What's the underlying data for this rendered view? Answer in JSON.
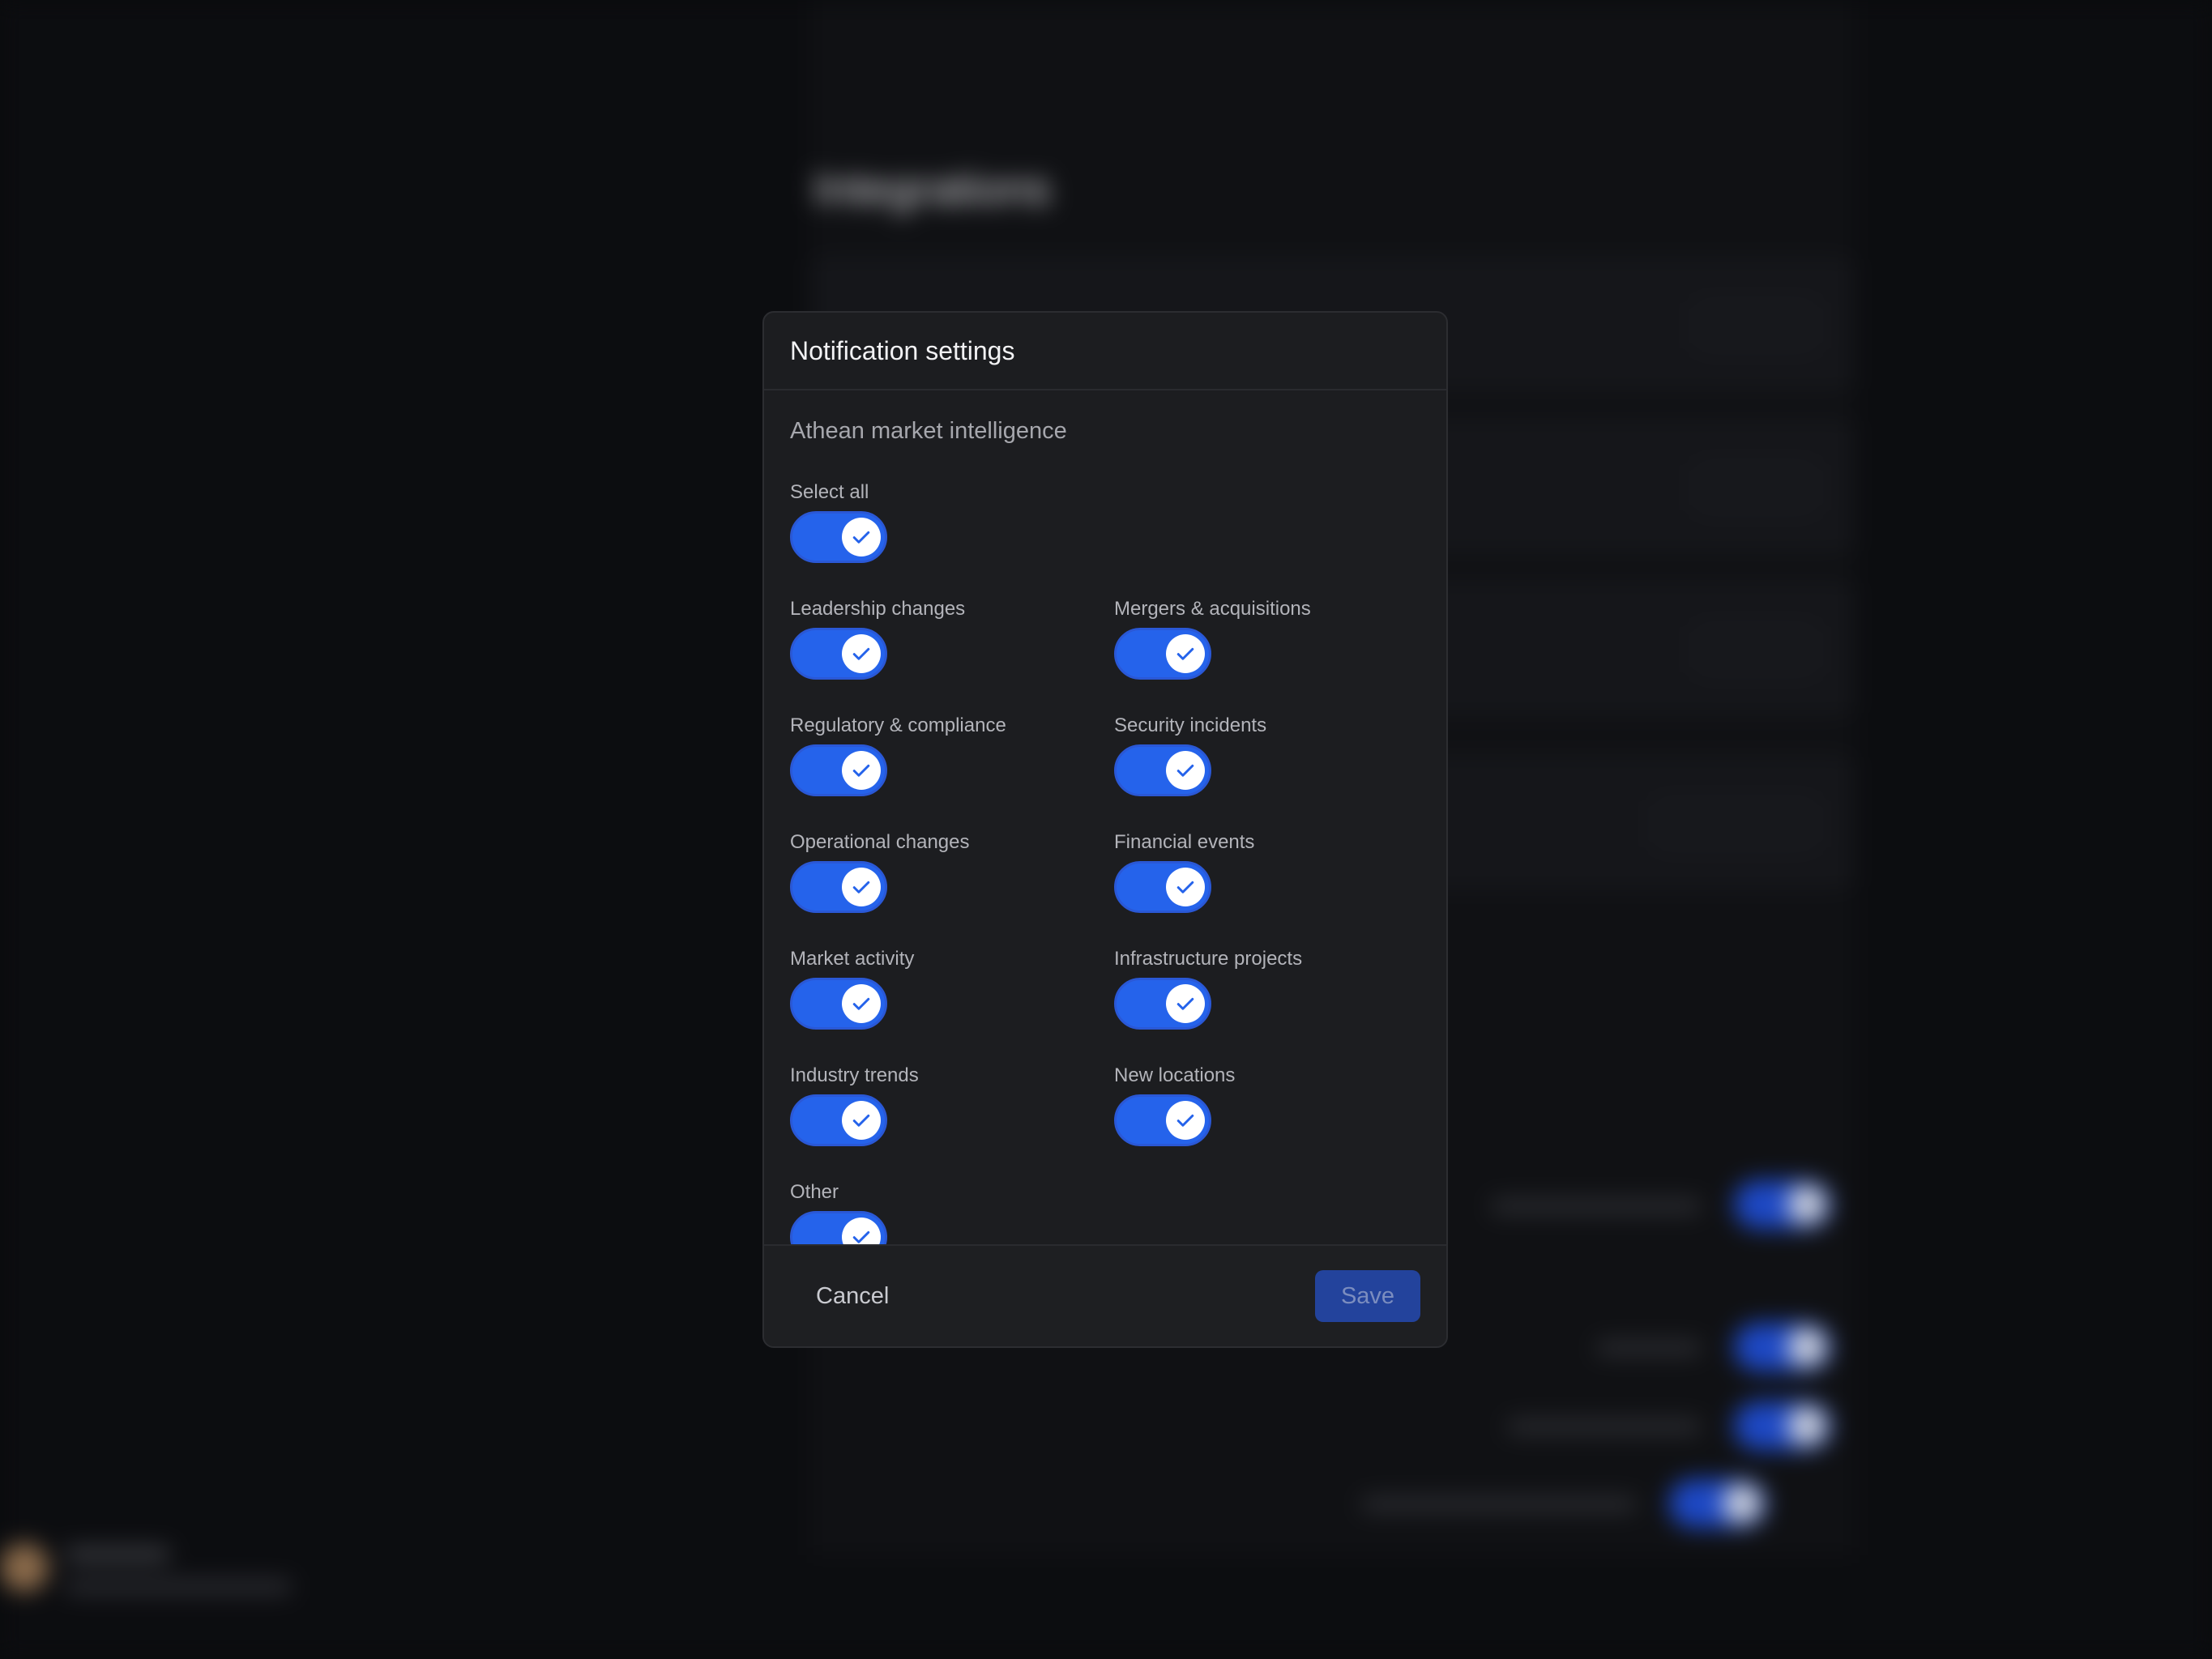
{
  "background": {
    "page_title": "Integrations"
  },
  "modal": {
    "title": "Notification settings",
    "section_title": "Athean market intelligence",
    "select_all": {
      "label": "Select all",
      "checked": true
    },
    "options": [
      {
        "label": "Leadership changes",
        "checked": true
      },
      {
        "label": "Mergers & acquisitions",
        "checked": true
      },
      {
        "label": "Regulatory & compliance",
        "checked": true
      },
      {
        "label": "Security incidents",
        "checked": true
      },
      {
        "label": "Operational changes",
        "checked": true
      },
      {
        "label": "Financial events",
        "checked": true
      },
      {
        "label": "Market activity",
        "checked": true
      },
      {
        "label": "Infrastructure projects",
        "checked": true
      },
      {
        "label": "Industry trends",
        "checked": true
      },
      {
        "label": "New locations",
        "checked": true
      },
      {
        "label": "Other",
        "checked": true
      }
    ],
    "cancel_label": "Cancel",
    "save_label": "Save"
  },
  "colors": {
    "toggle_on": "#2563eb",
    "modal_bg": "#1c1d20",
    "save_disabled_bg": "#23439c"
  },
  "icons": {
    "toggle_knob": "check-icon"
  }
}
